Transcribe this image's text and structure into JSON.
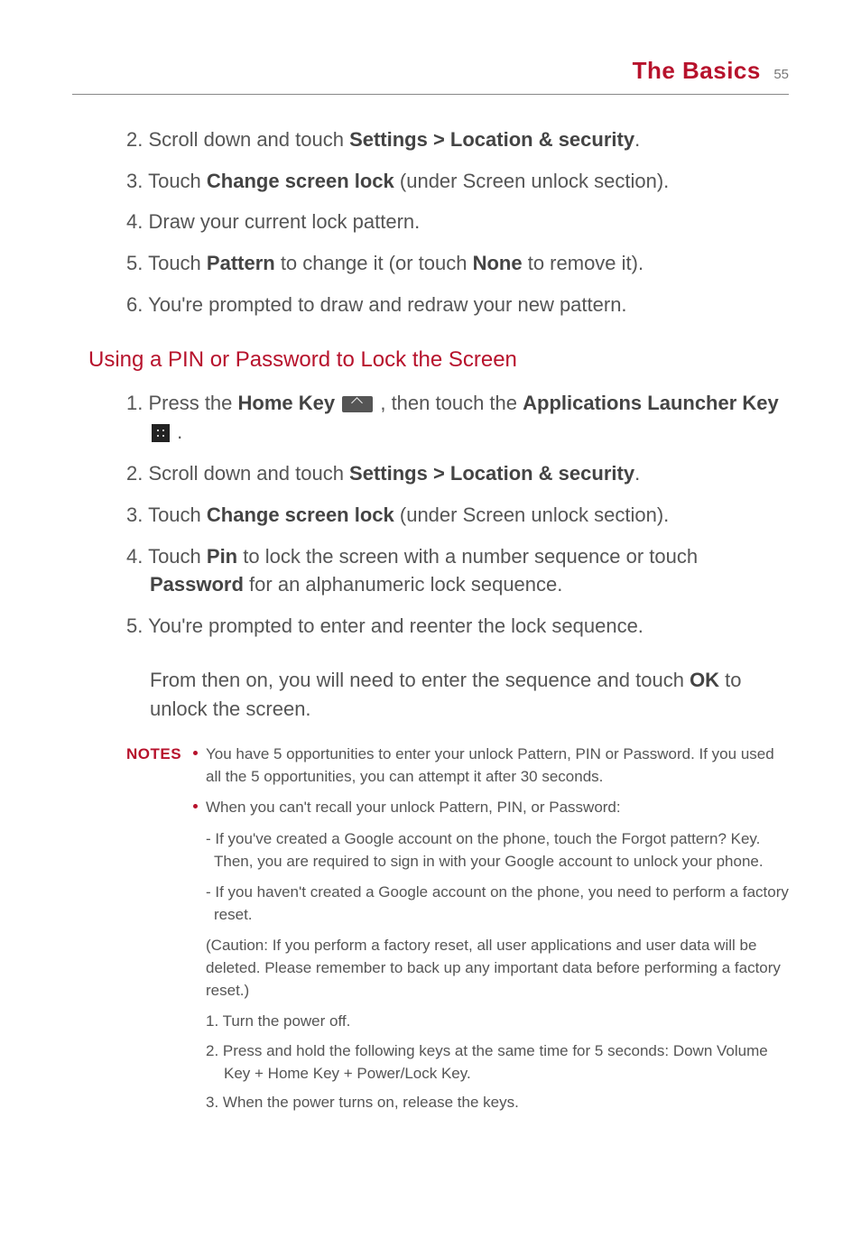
{
  "header": {
    "title": "The Basics",
    "page": "55"
  },
  "top_steps": [
    {
      "n": "2.",
      "pre": "Scroll down and touch ",
      "b1": "Settings > Location & security",
      "post": "."
    },
    {
      "n": "3.",
      "pre": "Touch ",
      "b1": "Change screen lock",
      "post": " (under Screen unlock section)."
    },
    {
      "n": "4.",
      "pre": "Draw your current lock pattern.",
      "b1": "",
      "post": ""
    },
    {
      "n": "5.",
      "pre": "Touch ",
      "b1": "Pattern",
      "mid": " to change it (or touch ",
      "b2": "None",
      "post": " to remove it)."
    },
    {
      "n": "6.",
      "pre": "You're prompted to draw and redraw your new pattern.",
      "b1": "",
      "post": ""
    }
  ],
  "section_heading": "Using a PIN or Password to Lock the Screen",
  "pin_steps": {
    "s1a": "Press the ",
    "s1b": "Home Key",
    "s1c": " , then touch the ",
    "s1d": "Applications Launcher Key",
    "s1e": " .",
    "s2a": "Scroll down and touch ",
    "s2b": "Settings > Location & security",
    "s2c": ".",
    "s3a": "Touch ",
    "s3b": "Change screen lock",
    "s3c": " (under Screen unlock section).",
    "s4a": "Touch ",
    "s4b": "Pin",
    "s4c": " to lock the screen with a number sequence or touch ",
    "s4d": "Password",
    "s4e": " for an alphanumeric lock sequence.",
    "s5": "You're prompted to enter and reenter the lock sequence."
  },
  "followup_a": "From then on, you will need to enter the sequence and touch ",
  "followup_b": "OK",
  "followup_c": " to unlock the screen.",
  "notes_label": "NOTES",
  "notes": {
    "b1": "You have 5 opportunities to enter your unlock Pattern, PIN or Password. If you used all the 5 opportunities, you can attempt it after 30 seconds.",
    "b2": "When you can't recall your unlock Pattern, PIN, or Password:",
    "d1": "- If you've created a Google account on the phone, touch the Forgot pattern? Key. Then, you are required to sign in with your Google account to unlock your phone.",
    "d2": "- If you haven't created a Google account on the phone, you need to perform a factory reset.",
    "paren": "(Caution: If you perform a factory reset, all user applications and user data will be deleted. Please remember to back up any important data before performing a factory reset.)",
    "i1": "1.  Turn the power off.",
    "i2": "2.  Press and hold the following keys at the same time for 5 seconds: Down Volume Key + Home Key + Power/Lock Key.",
    "i3": "3.  When the power turns on, release the keys."
  }
}
